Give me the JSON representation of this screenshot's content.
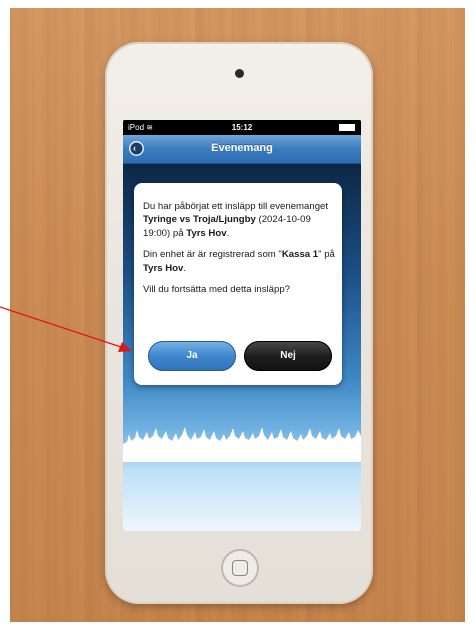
{
  "status_bar": {
    "carrier": "iPod",
    "time": "15:12"
  },
  "navbar": {
    "title": "Evenemang",
    "back_icon": "back-arrow-icon"
  },
  "dialog": {
    "p1_prefix": "Du har påbörjat ett insläpp till evenemanget ",
    "event_name": "Tyringe vs Troja/Ljungby",
    "event_datetime": " (2024-10-09 19:00) på ",
    "venue": "Tyrs Hov",
    "p1_suffix": ".",
    "p2_prefix": "Din enhet är är registrerad som \"",
    "device_name": "Kassa 1",
    "p2_middle": "\" på ",
    "p2_venue": "Tyrs Hov",
    "p2_suffix": ".",
    "question": "Vill du fortsätta med detta insläpp?",
    "yes_label": "Ja",
    "no_label": "Nej"
  },
  "colors": {
    "nav_blue": "#3a7bc0",
    "yes_button": "#3f86cc",
    "no_button": "#1f1f1f",
    "annotation_arrow": "#e0151b"
  }
}
